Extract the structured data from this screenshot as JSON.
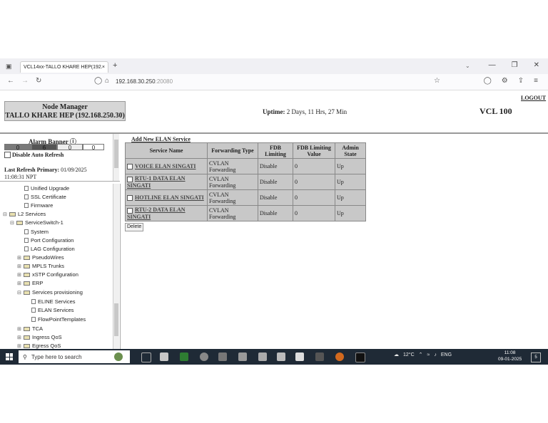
{
  "browser": {
    "tab_title": "VCL14xx-TALLO KHARE HEP(192.1 ",
    "tab_close": "×",
    "new_tab": "+",
    "url_main": "192.168.30.250",
    "url_port": ":20080",
    "min": "—",
    "restore": "❐",
    "close": "✕"
  },
  "header": {
    "node_manager": "Node Manager",
    "node_name": "TALLO KHARE HEP (192.168.250.30)",
    "uptime_label": "Uptime:",
    "uptime_value": "2 Days, 11 Hrs, 27 Min",
    "product": "VCL 100",
    "logout": "LOGOUT"
  },
  "alarm": {
    "title": "Alarm Banner",
    "counts": [
      "0",
      "6",
      "0",
      "0"
    ],
    "colors": [
      "#7a7a7a",
      "#555555",
      "#eeeeee",
      "#ffffff"
    ],
    "disable_auto_refresh": "Disable Auto Refresh",
    "last_refresh_label": "Last Refresh Primary:",
    "last_refresh_date": "01/09/2025",
    "last_refresh_time": "11:08:31 NPT"
  },
  "tree": {
    "items": [
      {
        "label": "Unified Upgrade"
      },
      {
        "label": "SSL Certificate"
      },
      {
        "label": "Firmware"
      },
      {
        "label": "L2 Services"
      },
      {
        "label": "ServiceSwitch-1"
      },
      {
        "label": "System"
      },
      {
        "label": "Port Configuration"
      },
      {
        "label": "LAG Configuration"
      },
      {
        "label": "PseudoWires"
      },
      {
        "label": "MPLS Trunks"
      },
      {
        "label": "xSTP Configuration"
      },
      {
        "label": "ERP"
      },
      {
        "label": "Services provisioning"
      },
      {
        "label": "ELINE Services"
      },
      {
        "label": "ELAN Services"
      },
      {
        "label": "FlowPointTemplates"
      },
      {
        "label": "TCA"
      },
      {
        "label": "Ingress QoS"
      },
      {
        "label": "Egress QoS"
      }
    ]
  },
  "main": {
    "add_link": "Add New ELAN Service",
    "columns": [
      "Service Name",
      "Forwarding Type",
      "FDB Limiting",
      "FDB Limiting Value",
      "Admin State"
    ],
    "rows": [
      {
        "name": "VOICE ELAN SINGATI",
        "fwd": "CVLAN Forwarding",
        "fdb": "Disable",
        "fdb_value": "0",
        "admin": "Up"
      },
      {
        "name": "RTU-1 DATA ELAN SINGATI",
        "fwd": "CVLAN Forwarding",
        "fdb": "Disable",
        "fdb_value": "0",
        "admin": "Up"
      },
      {
        "name": "HOTLINE ELAN SINGATI",
        "fwd": "CVLAN Forwarding",
        "fdb": "Disable",
        "fdb_value": "0",
        "admin": "Up"
      },
      {
        "name": "RTU-2 DATA ELAN SINGATI",
        "fwd": "CVLAN Forwarding",
        "fdb": "Disable",
        "fdb_value": "0",
        "admin": "Up"
      }
    ],
    "delete_label": "Delete"
  },
  "taskbar": {
    "search_placeholder": "Type here to search",
    "temperature": "12°C",
    "language": "ENG",
    "time": "11:08",
    "date": "09-01-2025",
    "notif_count": "5"
  }
}
